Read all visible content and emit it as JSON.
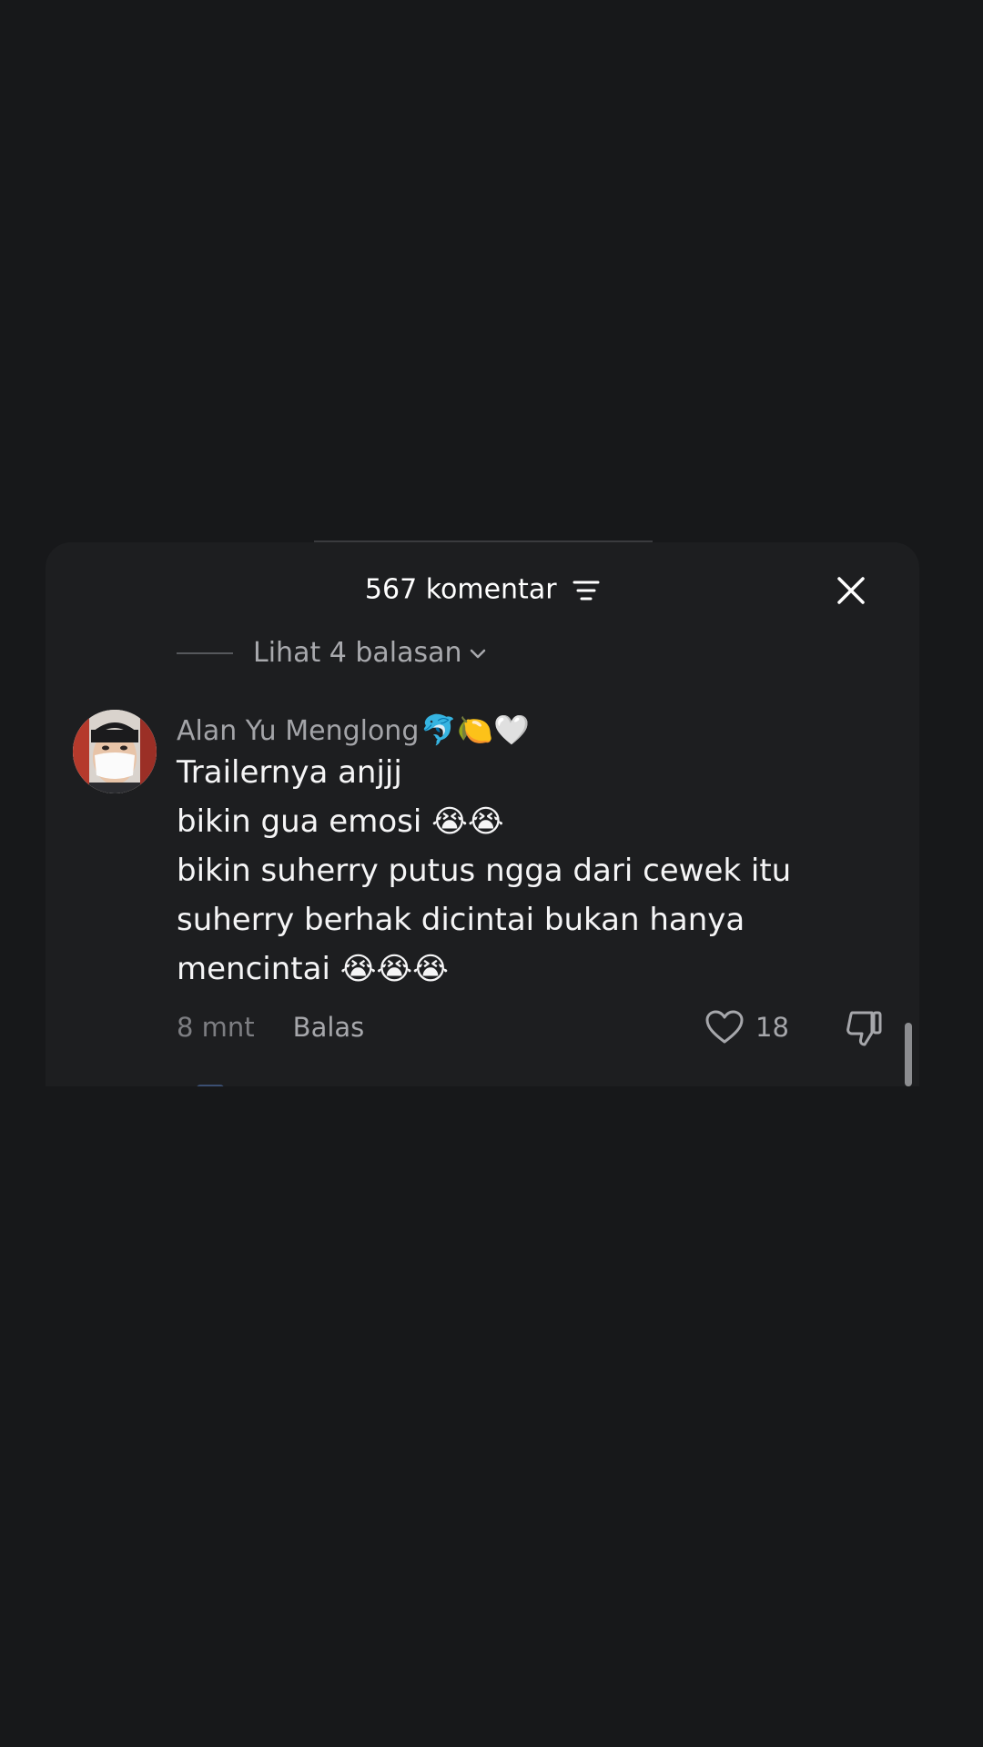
{
  "sheet": {
    "comment_count_label": "567 komentar",
    "filter_icon": "filter-lines-icon",
    "close_icon": "close-x-icon"
  },
  "replies_toggle": {
    "label": "Lihat 4 balasan",
    "icon": "chevron-down-icon"
  },
  "comment": {
    "username": "Alan Yu Menglong",
    "username_emojis": "🐬🍋🤍",
    "body_lines": [
      "Trailernya anjjj",
      "bikin gua emosi 😭😭",
      "bikin suherry putus ngga dari cewek itu",
      "suherry berhak dicintai bukan hanya",
      "mencintai 😭😭😭"
    ],
    "time": "8 mnt",
    "reply_label": "Balas",
    "like_count": "18",
    "like_icon": "heart-outline-icon",
    "dislike_icon": "thumbs-down-icon"
  },
  "colors": {
    "background": "#17181a",
    "sheet": "#1d1e20",
    "primary_text": "#f5f5f6",
    "secondary_text": "#a3a4a8",
    "muted_text": "#7d7e82"
  }
}
